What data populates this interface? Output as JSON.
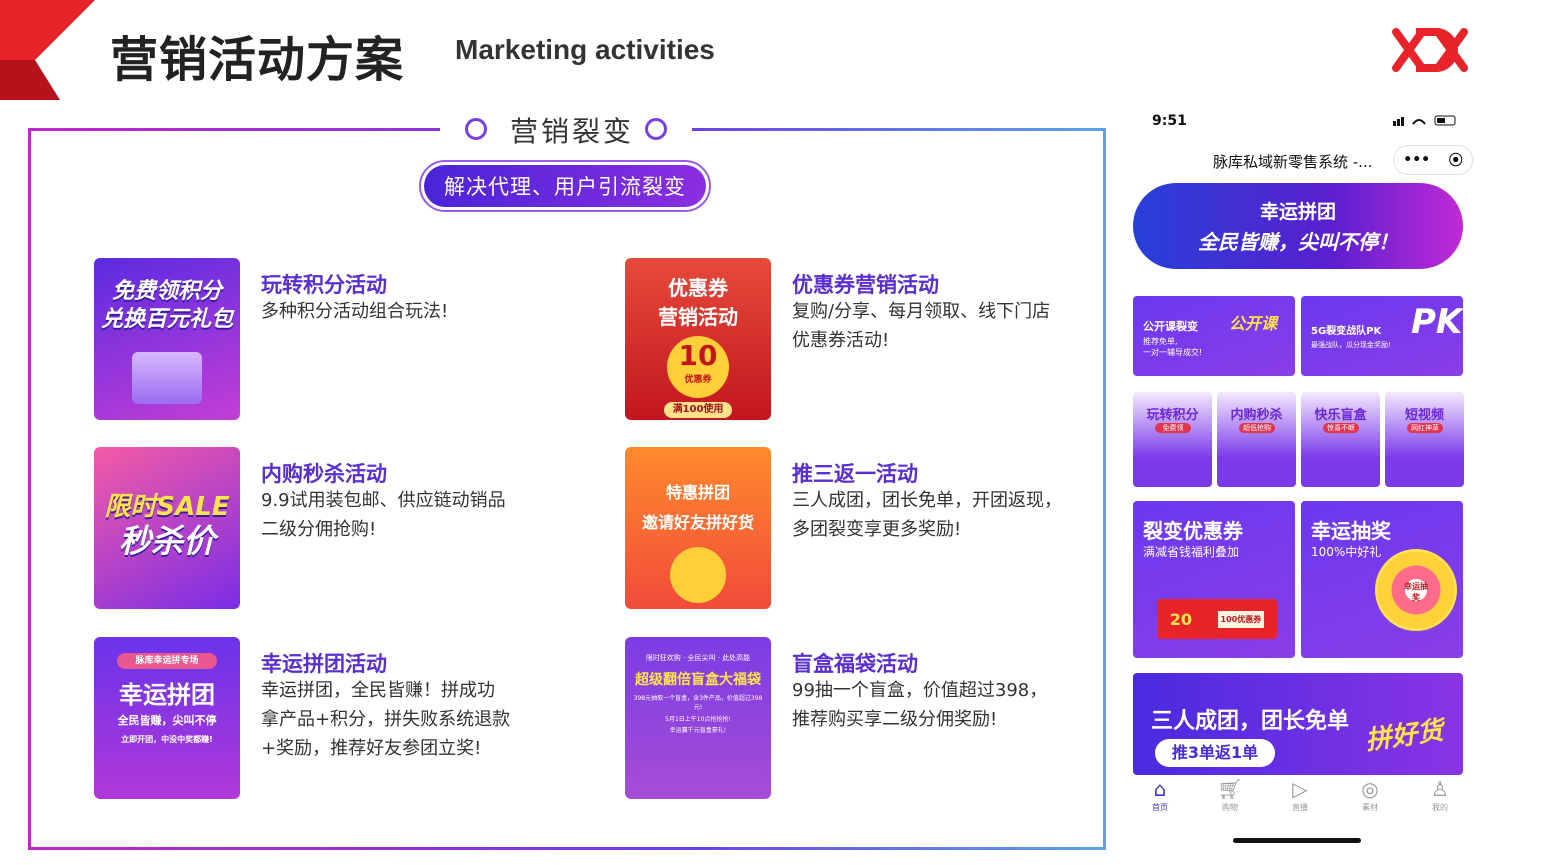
{
  "header": {
    "title_cn": "营销活动方案",
    "title_en": "Marketing activities"
  },
  "section": {
    "title": "营销裂变",
    "subtitle": "解决代理、用户引流裂变"
  },
  "activities": [
    {
      "title": "玩转积分活动",
      "desc": "多种积分活动组合玩法!",
      "img_lines": [
        "免费领积分",
        "兑换百元礼包"
      ]
    },
    {
      "title": "优惠券营销活动",
      "desc": "复购/分享、每月领取、线下门店优惠券活动!",
      "img_lines": [
        "优惠券",
        "营销活动"
      ],
      "img_extra": [
        "10",
        "优惠券",
        "满100使用"
      ]
    },
    {
      "title": "内购秒杀活动",
      "desc": "9.9试用装包邮、供应链动销品二级分佣抢购!",
      "img_lines": [
        "限时SALE",
        "秒杀价"
      ]
    },
    {
      "title": "推三返一活动",
      "desc": "三人成团，团长免单，开团返现，多团裂变享更多奖励!",
      "img_lines": [
        "特惠拼团",
        "邀请好友拼好货"
      ]
    },
    {
      "title": "幸运拼团活动",
      "desc": "幸运拼团，全民皆赚！拼成功拿产品+积分，拼失败系统退款+奖励，推荐好友参团立奖!",
      "img_lines": [
        "脉库幸运拼专场",
        "幸运拼团",
        "全民皆赚，尖叫不停",
        "立即开团，中没中奖都赚!"
      ]
    },
    {
      "title": "盲盒福袋活动",
      "desc": "99抽一个盲盒，价值超过398，推荐购买享二级分佣奖励!",
      "img_lines": [
        "限时狂欢购 · 全民尖叫 · 此处高能",
        "超级翻倍盲盒大福袋",
        "398元抽取一个盲盒，含3件产品，价值超过398元!",
        "5月1日上午10点抢抢抢!",
        "幸运赢千元盲盒豪礼!"
      ]
    }
  ],
  "phone": {
    "time": "9:51",
    "mini_title": "脉库私域新零售系统 -...",
    "capsule_more": "•••",
    "capsule_close": "⦿",
    "banner": {
      "line1": "幸运拼团",
      "line2": "全民皆赚，尖叫不停！"
    },
    "tile_left": {
      "title": "公开课裂变",
      "sub1": "推荐免单,",
      "sub2": "一对一辅导成交!",
      "badge": "公开课"
    },
    "tile_right": {
      "title": "5G裂变战队PK",
      "sub": "最强战队，瓜分现金奖励!",
      "badge": "PK"
    },
    "small_cards": [
      {
        "label": "玩转积分",
        "tag": "免费领"
      },
      {
        "label": "内购秒杀",
        "tag": "超低抢购"
      },
      {
        "label": "快乐盲盒",
        "tag": "惊喜不断"
      },
      {
        "label": "短视频",
        "tag": "网红神草"
      }
    ],
    "coupon_tile": {
      "title": "裂变优惠券",
      "sub": "满减省钱福利叠加",
      "amount": "20",
      "tag": "100优惠券"
    },
    "lottery_tile": {
      "title": "幸运抽奖",
      "sub": "100%中好礼",
      "center": "幸运抽奖"
    },
    "bottom_banner": {
      "title": "三人成团，团长免单",
      "pill": "推3单返1单",
      "badge": "拼好货"
    },
    "tabs": [
      {
        "label": "首页",
        "icon": "home-icon"
      },
      {
        "label": "购物",
        "icon": "cart-icon"
      },
      {
        "label": "直播",
        "icon": "live-icon"
      },
      {
        "label": "素材",
        "icon": "compass-icon"
      },
      {
        "label": "我的",
        "icon": "user-icon"
      }
    ]
  },
  "colors": {
    "accent": "#5a2ed0",
    "brand_red": "#e8232a",
    "frame_start": "#c027c8",
    "frame_end": "#5aa3ea"
  }
}
